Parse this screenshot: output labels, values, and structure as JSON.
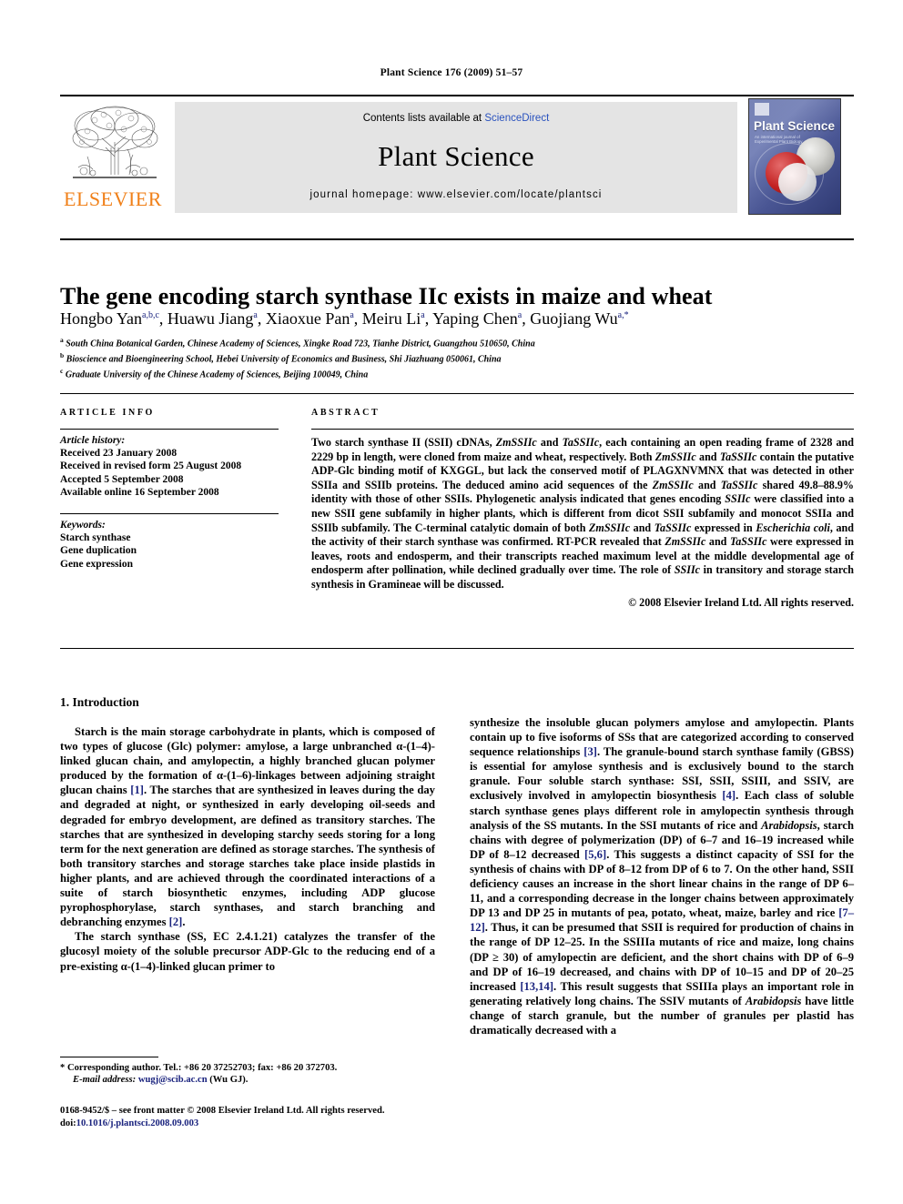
{
  "running_head": "Plant Science 176 (2009) 51–57",
  "masthead": {
    "publisher_name": "ELSEVIER",
    "publisher_logo_alt": "elsevier-tree-logo",
    "contents_prefix": "Contents lists available at ",
    "contents_link": "ScienceDirect",
    "journal_name": "Plant Science",
    "homepage": "journal homepage: www.elsevier.com/locate/plantsci",
    "cover": {
      "title": "Plant Science",
      "subtitle": "An international journal of Experimental Plant Biology"
    },
    "link_color": "#2a52be",
    "elsevier_orange": "#F08019"
  },
  "article": {
    "title": "The gene encoding starch synthase IIc exists in maize and wheat",
    "authors": [
      {
        "name": "Hongbo Yan",
        "sup": "a,b,c",
        "sep": ", "
      },
      {
        "name": "Huawu Jiang",
        "sup": "a",
        "sep": ", "
      },
      {
        "name": "Xiaoxue Pan",
        "sup": "a",
        "sep": ", "
      },
      {
        "name": "Meiru Li",
        "sup": "a",
        "sep": ", "
      },
      {
        "name": "Yaping Chen",
        "sup": "a",
        "sep": ", "
      },
      {
        "name": "Guojiang Wu",
        "sup": "a,*",
        "sep": ""
      }
    ],
    "affiliations": [
      {
        "mark": "a",
        "text": "South China Botanical Garden, Chinese Academy of Sciences, Xingke Road 723, Tianhe District, Guangzhou 510650, China"
      },
      {
        "mark": "b",
        "text": "Bioscience and Bioengineering School, Hebei University of Economics and Business, Shi Jiazhuang 050061, China"
      },
      {
        "mark": "c",
        "text": "Graduate University of the Chinese Academy of Sciences, Beijing 100049, China"
      }
    ]
  },
  "article_info": {
    "heading": "ARTICLE INFO",
    "history_label": "Article history:",
    "history": [
      "Received 23 January 2008",
      "Received in revised form 25 August 2008",
      "Accepted 5 September 2008",
      "Available online 16 September 2008"
    ],
    "keywords_label": "Keywords:",
    "keywords": [
      "Starch synthase",
      "Gene duplication",
      "Gene expression"
    ]
  },
  "abstract": {
    "heading": "ABSTRACT",
    "text": "Two starch synthase II (SSII) cDNAs, ZmSSIIc and TaSSIIc, each containing an open reading frame of 2328 and 2229 bp in length, were cloned from maize and wheat, respectively. Both ZmSSIIc and TaSSIIc contain the putative ADP-Glc binding motif of KXGGL, but lack the conserved motif of PLAGXNVMNX that was detected in other SSIIa and SSIIb proteins. The deduced amino acid sequences of the ZmSSIIc and TaSSIIc shared 49.8–88.9% identity with those of other SSIIs. Phylogenetic analysis indicated that genes encoding SSIIc were classified into a new SSII gene subfamily in higher plants, which is different from dicot SSII subfamily and monocot SSIIa and SSIIb subfamily. The C-terminal catalytic domain of both ZmSSIIc and TaSSIIc expressed in Escherichia coli, and the activity of their starch synthase was confirmed. RT-PCR revealed that ZmSSIIc and TaSSIIc were expressed in leaves, roots and endosperm, and their transcripts reached maximum level at the middle developmental age of endosperm after pollination, while declined gradually over time. The role of SSIIc in transitory and storage starch synthesis in Gramineae will be discussed.",
    "copyright": "© 2008 Elsevier Ireland Ltd. All rights reserved."
  },
  "body": {
    "section_number_title": "1. Introduction",
    "left_paragraphs": [
      "Starch is the main storage carbohydrate in plants, which is composed of two types of glucose (Glc) polymer: amylose, a large unbranched α-(1–4)-linked glucan chain, and amylopectin, a highly branched glucan polymer produced by the formation of α-(1–6)-linkages between adjoining straight glucan chains [1]. The starches that are synthesized in leaves during the day and degraded at night, or synthesized in early developing oil-seeds and degraded for embryo development, are defined as transitory starches. The starches that are synthesized in developing starchy seeds storing for a long term for the next generation are defined as storage starches. The synthesis of both transitory starches and storage starches take place inside plastids in higher plants, and are achieved through the coordinated interactions of a suite of starch biosynthetic enzymes, including ADP glucose pyrophosphorylase, starch synthases, and starch branching and debranching enzymes [2].",
      "The starch synthase (SS, EC 2.4.1.21) catalyzes the transfer of the glucosyl moiety of the soluble precursor ADP-Glc to the reducing end of a pre-existing α-(1–4)-linked glucan primer to"
    ],
    "right_paragraphs": [
      "synthesize the insoluble glucan polymers amylose and amylopectin. Plants contain up to five isoforms of SSs that are categorized according to conserved sequence relationships [3]. The granule-bound starch synthase family (GBSS) is essential for amylose synthesis and is exclusively bound to the starch granule. Four soluble starch synthase: SSI, SSII, SSIII, and SSIV, are exclusively involved in amylopectin biosynthesis [4]. Each class of soluble starch synthase genes plays different role in amylopectin synthesis through analysis of the SS mutants. In the SSI mutants of rice and Arabidopsis, starch chains with degree of polymerization (DP) of 6–7 and 16–19 increased while DP of 8–12 decreased [5,6]. This suggests a distinct capacity of SSI for the synthesis of chains with DP of 8–12 from DP of 6 to 7. On the other hand, SSII deficiency causes an increase in the short linear chains in the range of DP 6–11, and a corresponding decrease in the longer chains between approximately DP 13 and DP 25 in mutants of pea, potato, wheat, maize, barley and rice [7–12]. Thus, it can be presumed that SSII is required for production of chains in the range of DP 12–25. In the SSIIIa mutants of rice and maize, long chains (DP ≥ 30) of amylopectin are deficient, and the short chains with DP of 6–9 and DP of 16–19 decreased, and chains with DP of 10–15 and DP of 20–25 increased [13,14]. This result suggests that SSIIIa plays an important role in generating relatively long chains. The SSIV mutants of Arabidopsis have little change of starch granule, but the number of granules per plastid has dramatically decreased with a"
    ]
  },
  "footnote": {
    "marker": "*",
    "corresponding": "Corresponding author. Tel.: +86 20 37252703; fax: +86 20 372703.",
    "email_label": "E-mail address:",
    "email": "wugj@scib.ac.cn",
    "email_suffix": "(Wu GJ)."
  },
  "footer": {
    "issn_line": "0168-9452/$ – see front matter © 2008 Elsevier Ireland Ltd. All rights reserved.",
    "doi_label": "doi:",
    "doi": "10.1016/j.plantsci.2008.09.003"
  }
}
